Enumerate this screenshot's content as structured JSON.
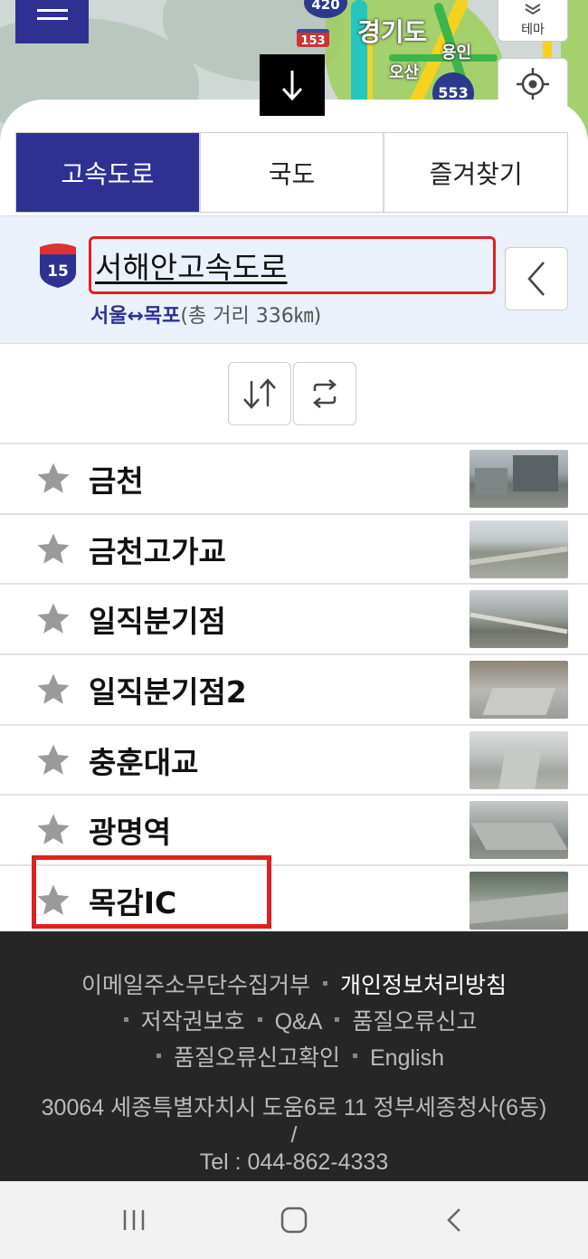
{
  "map": {
    "labels": [
      "경기도",
      "용인",
      "오산"
    ],
    "route_badges": [
      "153",
      "553",
      "420"
    ],
    "theme_label": "테마",
    "down_arrow": "↓"
  },
  "tabs": [
    {
      "label": "고속도로",
      "active": true
    },
    {
      "label": "국도",
      "active": false
    },
    {
      "label": "즐겨찾기",
      "active": false
    }
  ],
  "route": {
    "shield_number": "15",
    "name": "서해안고속도로",
    "span": "서울↔목포",
    "distance": "(총 거리 336㎞)"
  },
  "cctv_list": [
    {
      "name": "금천"
    },
    {
      "name": "금천고가교"
    },
    {
      "name": "일직분기점"
    },
    {
      "name": "일직분기점2"
    },
    {
      "name": "충훈대교"
    },
    {
      "name": "광명역"
    },
    {
      "name": "목감IC"
    }
  ],
  "footer": {
    "links": [
      "이메일주소무단수집거부",
      "개인정보처리방침",
      "저작권보호",
      "Q&A",
      "품질오류신고",
      "품질오류신고확인",
      "English"
    ],
    "address": "30064 세종특별자치시 도움6로 11 정부세종청사(6동)",
    "slash": "/",
    "tel": "Tel : 044-862-4333"
  },
  "colors": {
    "brand": "#2e3192",
    "highlight": "#e02020",
    "footer_bg": "#262626"
  },
  "icons": [
    "menu-icon",
    "layers-icon",
    "locate-icon",
    "down-arrow-icon",
    "chevron-left-icon",
    "sort-icon",
    "swap-icon",
    "star-icon",
    "recent-apps-icon",
    "home-icon",
    "back-icon"
  ]
}
